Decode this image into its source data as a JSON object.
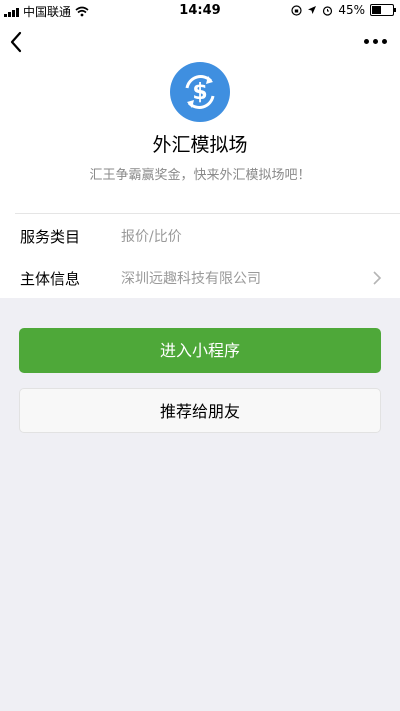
{
  "status_bar": {
    "carrier": "中国联通",
    "time": "14:49",
    "battery_percent": "45%",
    "battery_level": 0.45
  },
  "app": {
    "name": "外汇模拟场",
    "description": "汇王争霸赢奖金，快来外汇模拟场吧！",
    "logo_icon": "currency-exchange-icon",
    "logo_color": "#3f8fe0"
  },
  "info": [
    {
      "label": "服务类目",
      "value": "报价/比价"
    },
    {
      "label": "主体信息",
      "value": "深圳远趣科技有限公司"
    }
  ],
  "buttons": {
    "enter": "进入小程序",
    "recommend": "推荐给朋友"
  },
  "colors": {
    "primary": "#4ea839",
    "background": "#efeff4"
  }
}
